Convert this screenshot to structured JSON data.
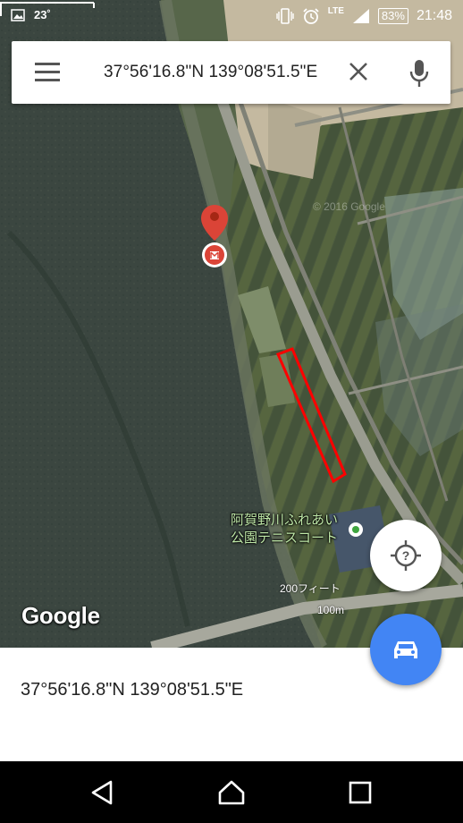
{
  "status_bar": {
    "temperature": "23˚",
    "network": "LTE",
    "battery": "83%",
    "time": "21:48",
    "icons": [
      "image-icon",
      "vibrate-icon",
      "alarm-icon",
      "signal-icon",
      "battery-icon"
    ]
  },
  "search": {
    "query": "37°56'16.8\"N 139°08'51.5\"E",
    "icons": [
      "menu-icon",
      "close-icon",
      "mic-icon"
    ]
  },
  "map": {
    "poi_label_line1": "阿賀野川ふれあい",
    "poi_label_line2": "公園テニスコート",
    "scale_feet": "200フィート",
    "scale_meters": "100m",
    "logo": "Google",
    "copyright": "© 2016 Google",
    "pin_color": "#db4437",
    "highlight_color": "#ff0000"
  },
  "fabs": {
    "location_icon": "location-unknown-icon",
    "directions_icon": "car-icon",
    "directions_color": "#4285f4"
  },
  "place_sheet": {
    "coordinates": "37°56'16.8\"N 139°08'51.5\"E"
  },
  "nav_bar": {
    "icons": [
      "back-icon",
      "home-icon",
      "recents-icon"
    ]
  }
}
